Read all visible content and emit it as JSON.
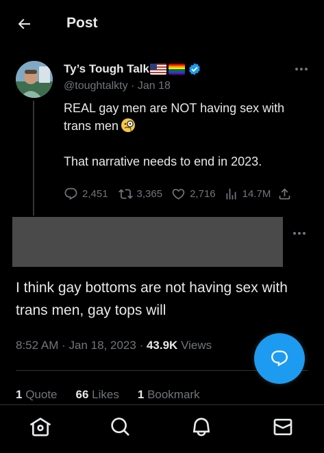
{
  "header": {
    "title": "Post",
    "back_icon": "arrow-left-icon"
  },
  "tweet": {
    "display_name": "Ty’s Tough Talk",
    "handle": "@toughtalkty",
    "separator": "·",
    "date": "Jan 18",
    "text_line1": "REAL gay men are NOT having sex with trans men",
    "text_emoji": "monocle-face-emoji",
    "text_para2": "That narrative needs to end in 2023.",
    "replies": "2,451",
    "retweets": "3,365",
    "likes": "2,716",
    "views": "14.7M",
    "flags": [
      "us-flag",
      "rainbow-flag"
    ]
  },
  "reply": {
    "text": "I think gay bottoms are not having sex with trans men, gay tops will",
    "time": "8:52 AM",
    "separator": "·",
    "date": "Jan 18, 2023",
    "separator2": "·",
    "views_count": "43.9K",
    "views_label": "Views",
    "quotes_count": "1",
    "quotes_label": "Quote",
    "likes_count": "66",
    "likes_label": "Likes",
    "bookmarks_count": "1",
    "bookmarks_label": "Bookmark"
  },
  "nav": [
    "home-icon",
    "search-icon",
    "notifications-icon",
    "messages-icon"
  ],
  "colors": {
    "accent": "#1d9bf0",
    "muted": "#71767b",
    "text": "#e7e9ea",
    "background": "#000000"
  }
}
